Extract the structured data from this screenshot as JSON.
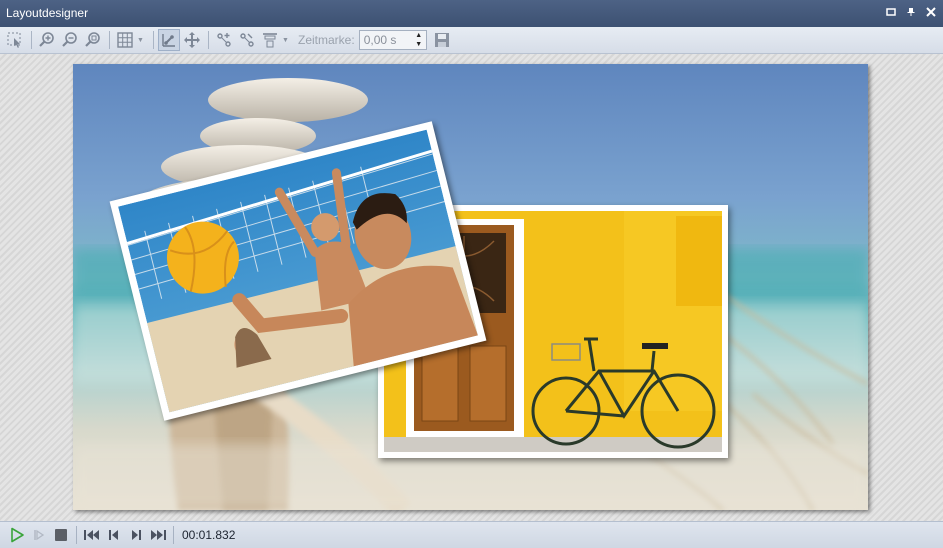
{
  "window": {
    "title": "Layoutdesigner",
    "buttons": [
      "restore-icon",
      "pin-icon",
      "close-icon"
    ]
  },
  "toolbar": {
    "buttons": [
      {
        "name": "select-tool",
        "icon": "selection-icon"
      },
      {
        "name": "zoom-in",
        "icon": "zoom-in-icon"
      },
      {
        "name": "zoom-out",
        "icon": "zoom-out-icon"
      },
      {
        "name": "zoom-fit",
        "icon": "zoom-fit-icon"
      },
      {
        "name": "grid",
        "icon": "grid-icon"
      },
      {
        "name": "snap-guides",
        "icon": "guides-icon",
        "active": true
      },
      {
        "name": "move-tool",
        "icon": "move-icon"
      },
      {
        "name": "path-add",
        "icon": "path-add-icon"
      },
      {
        "name": "path-edit",
        "icon": "path-edit-icon"
      },
      {
        "name": "align",
        "icon": "align-icon"
      },
      {
        "name": "save",
        "icon": "save-icon"
      }
    ],
    "time_label": "Zeitmarke:",
    "time_value": "0,00 s"
  },
  "playback": {
    "time": "00:01.832",
    "buttons": [
      "play-icon",
      "play-from-icon",
      "stop-icon",
      "skip-start-icon",
      "prev-frame-icon",
      "next-frame-icon",
      "skip-end-icon"
    ]
  },
  "colors": {
    "titlebar": "#45597b",
    "toolbar": "#dfe5ee",
    "accent_green": "#3aa43a"
  }
}
